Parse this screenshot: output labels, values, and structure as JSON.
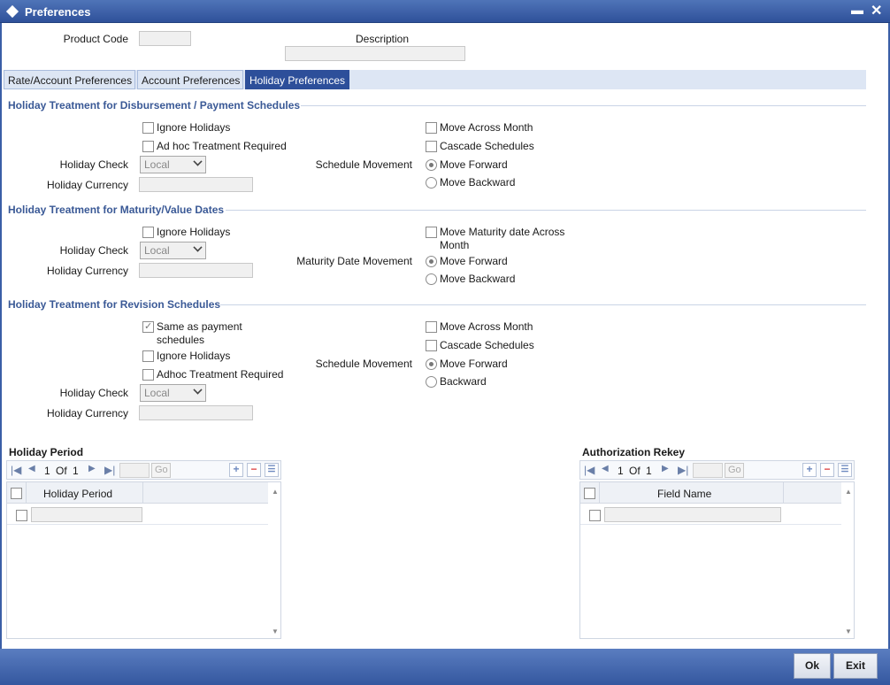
{
  "window": {
    "title": "Preferences",
    "minimize_glyph": "▬",
    "close_glyph": "✕"
  },
  "header": {
    "product_code_label": "Product Code",
    "product_code_value": "",
    "description_label": "Description",
    "description_value": ""
  },
  "tabs": [
    {
      "label": "Rate/Account Preferences",
      "active": false
    },
    {
      "label": "Account Preferences",
      "active": false
    },
    {
      "label": "Holiday Preferences",
      "active": true
    }
  ],
  "disbursement": {
    "title": "Holiday Treatment for Disbursement / Payment Schedules",
    "ignore_holidays": {
      "label": "Ignore Holidays",
      "checked": false
    },
    "adhoc": {
      "label": "Ad hoc Treatment Required",
      "checked": false
    },
    "holiday_check_label": "Holiday Check",
    "holiday_check_value": "Local",
    "holiday_currency_label": "Holiday Currency",
    "holiday_currency_value": "",
    "move_across_month": {
      "label": "Move Across Month",
      "checked": false
    },
    "cascade": {
      "label": "Cascade Schedules",
      "checked": false
    },
    "schedule_movement_label": "Schedule Movement",
    "move_forward": {
      "label": "Move Forward",
      "checked": true
    },
    "move_backward": {
      "label": "Move Backward",
      "checked": false
    }
  },
  "maturity": {
    "title": "Holiday Treatment for Maturity/Value Dates",
    "ignore_holidays": {
      "label": "Ignore Holidays",
      "checked": false
    },
    "holiday_check_label": "Holiday Check",
    "holiday_check_value": "Local",
    "holiday_currency_label": "Holiday Currency",
    "holiday_currency_value": "",
    "move_maturity_line1": "Move Maturity date Across",
    "move_maturity_line2": "Month",
    "move_maturity_checked": false,
    "maturity_movement_label": "Maturity Date Movement",
    "move_forward": {
      "label": "Move Forward",
      "checked": true
    },
    "move_backward": {
      "label": "Move Backward",
      "checked": false
    }
  },
  "revision": {
    "title": "Holiday Treatment for Revision Schedules",
    "same_as_payment_line1": "Same as payment",
    "same_as_payment_line2": "schedules",
    "same_as_payment_checked": true,
    "ignore_holidays": {
      "label": "Ignore Holidays",
      "checked": false
    },
    "adhoc": {
      "label": "Adhoc Treatment Required",
      "checked": false
    },
    "holiday_check_label": "Holiday Check",
    "holiday_check_value": "Local",
    "holiday_currency_label": "Holiday Currency",
    "holiday_currency_value": "",
    "move_across_month": {
      "label": "Move Across Month",
      "checked": false
    },
    "cascade": {
      "label": "Cascade Schedules",
      "checked": false
    },
    "schedule_movement_label": "Schedule Movement",
    "move_forward": {
      "label": "Move Forward",
      "checked": true
    },
    "backward": {
      "label": "Backward",
      "checked": false
    }
  },
  "holiday_period_grid": {
    "title": "Holiday Period",
    "page": "1",
    "of_label": "Of",
    "total": "1",
    "go_label": "Go",
    "column": "Holiday Period"
  },
  "auth_rekey_grid": {
    "title": "Authorization Rekey",
    "page": "1",
    "of_label": "Of",
    "total": "1",
    "go_label": "Go",
    "column": "Field Name"
  },
  "footer": {
    "ok_label": "Ok",
    "exit_label": "Exit"
  },
  "icons": {
    "first": "⏮",
    "prev": "◀",
    "next": "▶",
    "last": "⏭",
    "add": "+",
    "remove": "−",
    "list": "☰"
  }
}
